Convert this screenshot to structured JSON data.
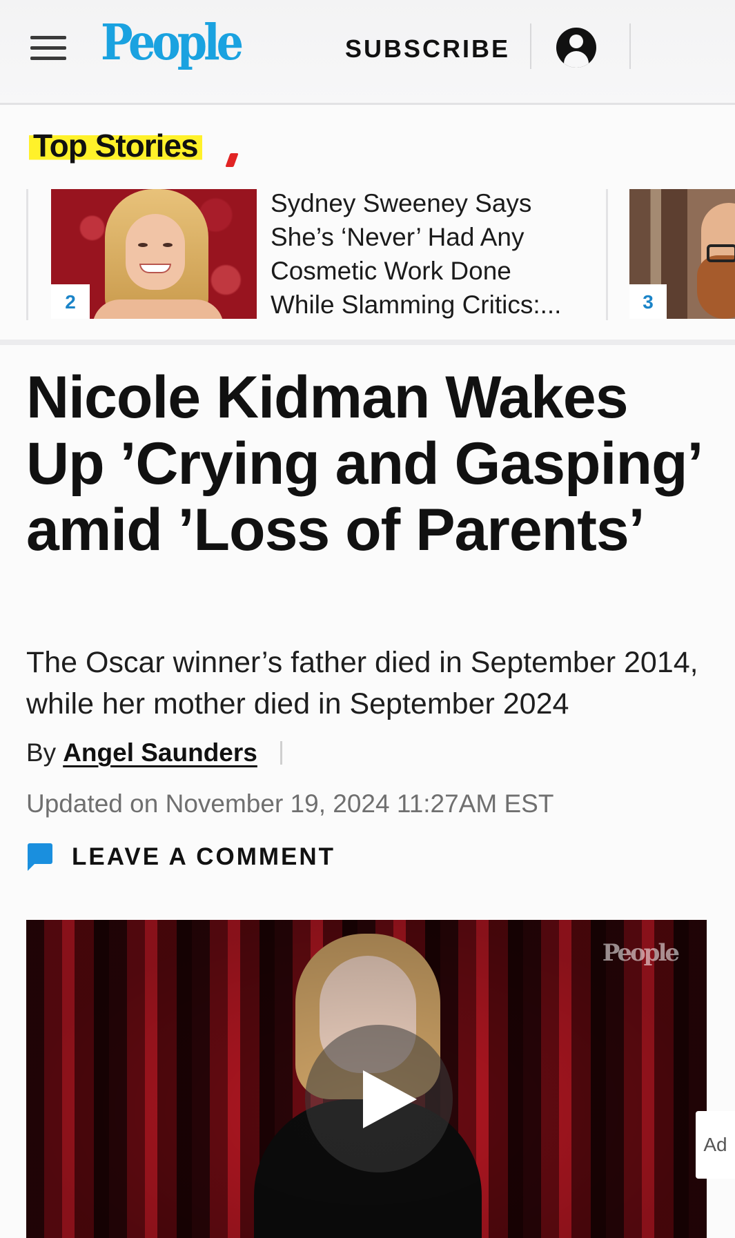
{
  "header": {
    "logo": "People",
    "subscribe_label": "SUBSCRIBE"
  },
  "top_stories": {
    "label": "Top Stories",
    "items": [
      {
        "rank": "2",
        "title": "Sydney Sweeney Says She’s ‘Never’ Had Any Cosmetic Work Done While Slamming Critics:..."
      },
      {
        "rank": "3",
        "title": ""
      }
    ]
  },
  "article": {
    "headline": "Nicole Kidman Wakes Up ’Crying and Gasping’ amid ’Loss of Parents’",
    "dek": "The Oscar winner’s father died in September 2014, while her mother died in September 2024",
    "byline_prefix": "By",
    "author": "Angel Saunders",
    "updated": "Updated on November 19, 2024 11:27AM EST",
    "comment_label": "LEAVE A COMMENT"
  },
  "video": {
    "watermark": "People"
  },
  "ad": {
    "label": "Ad"
  },
  "colors": {
    "brand_blue": "#1aa2e0",
    "highlight_yellow": "#fff12a",
    "comment_icon_blue": "#1a8fde"
  },
  "icons": [
    "hamburger-menu-icon",
    "account-icon",
    "comment-icon",
    "play-icon"
  ]
}
